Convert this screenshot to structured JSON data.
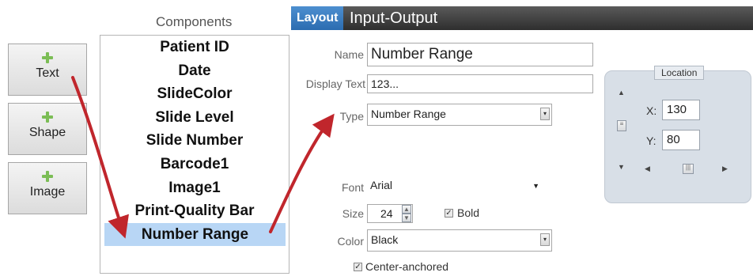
{
  "buttons": [
    {
      "label": "Text"
    },
    {
      "label": "Shape"
    },
    {
      "label": "Image"
    }
  ],
  "components": {
    "title": "Components",
    "items": [
      "Patient ID",
      "Date",
      "SlideColor",
      "Slide Level",
      "Slide Number",
      "Barcode1",
      "Image1",
      "Print-Quality Bar",
      "Number Range"
    ],
    "selected": "Number Range"
  },
  "tabs": {
    "layout": "Layout",
    "input_output": "Input-Output"
  },
  "form": {
    "name_label": "Name",
    "name_value": "Number Range",
    "display_label": "Display Text",
    "display_value": "123...",
    "type_label": "Type",
    "type_value": "Number Range",
    "font_label": "Font",
    "font_value": "Arial",
    "size_label": "Size",
    "size_value": "24",
    "bold_label": "Bold",
    "color_label": "Color",
    "color_value": "Black",
    "center_label": "Center-anchored"
  },
  "location": {
    "title": "Location",
    "x_label": "X:",
    "x_value": "130",
    "y_label": "Y:",
    "y_value": "80"
  },
  "colors": {
    "accent_tab": "#2b6cb0",
    "selection": "#b8d6f5",
    "arrow": "#c0262c",
    "plus": "#7bbd55"
  }
}
